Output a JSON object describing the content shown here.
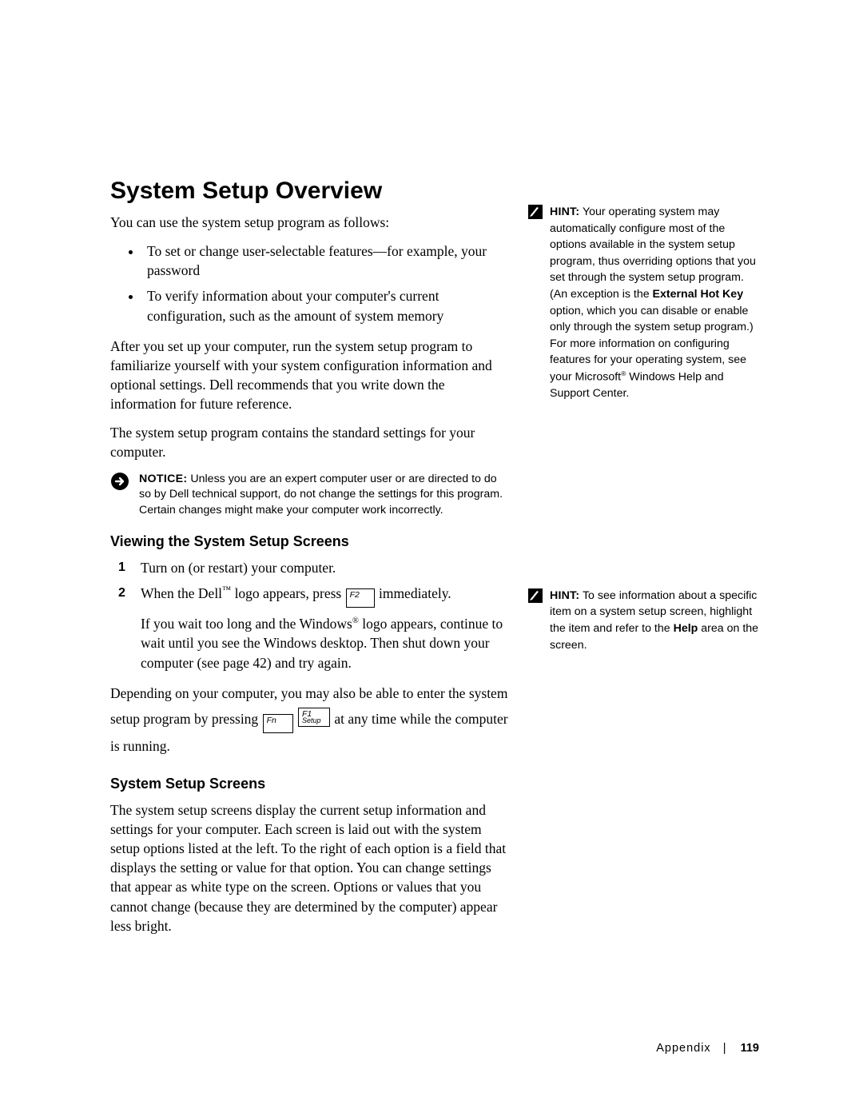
{
  "title": "System Setup Overview",
  "intro": "You can use the system setup program as follows:",
  "bullets": [
    "To set or change user-selectable features—for example, your password",
    "To verify information about your computer's current configuration, such as the amount of system memory"
  ],
  "para_after_bullets": "After you set up your computer, run the system setup program to familiarize yourself with your system configuration information and optional settings. Dell recommends that you write down the information for future reference.",
  "para_standard": "The system setup program contains the standard settings for your computer.",
  "notice": {
    "label": "NOTICE:",
    "text": "Unless you are an expert computer user or are directed to do so by Dell technical support, do not change the settings for this program. Certain changes might make your computer work incorrectly."
  },
  "section_view": {
    "heading": "Viewing the System Setup Screens",
    "step1": "Turn on (or restart) your computer.",
    "step2_a": "When the Dell",
    "step2_tm": "™",
    "step2_b": " logo appears, press ",
    "step2_c": " immediately.",
    "step2_sub_a": "If you wait too long and the Windows",
    "step2_sub_reg": "®",
    "step2_sub_b": " logo appears, continue to wait until you see the Windows desktop. Then shut down your computer (see page 42) and try again.",
    "depending_a": "Depending on your computer, you may also be able to enter the system setup program by pressing ",
    "depending_b": " at any time while the computer is running."
  },
  "keys": {
    "f2": "F2",
    "fn": "Fn",
    "f1_top": "F1",
    "f1_bot": "Setup"
  },
  "section_screens": {
    "heading": "System Setup Screens",
    "para": "The system setup screens display the current setup information and settings for your computer. Each screen is laid out with the system setup options listed at the left. To the right of each option is a field that displays the setting or value for that option. You can change settings that appear as white type on the screen. Options or values that you cannot change (because they are determined by the computer) appear less bright."
  },
  "hint1": {
    "label": "HINT:",
    "text_a": "Your operating system may automatically configure most of the options available in the system setup program, thus overriding options that you set through the system setup program. (An exception is the ",
    "bold1": "External Hot Key",
    "text_b": " option, which you can disable or enable only through the system setup program.) For more information on configuring features for your operating system, see your Microsoft",
    "reg": "®",
    "text_c": " Windows Help and Support Center."
  },
  "hint2": {
    "label": "HINT:",
    "text_a": "To see information about a specific item on a system setup screen, highlight the item and refer to the ",
    "bold1": "Help",
    "text_b": " area on the screen."
  },
  "footer": {
    "section": "Appendix",
    "sep": "|",
    "page": "119"
  }
}
